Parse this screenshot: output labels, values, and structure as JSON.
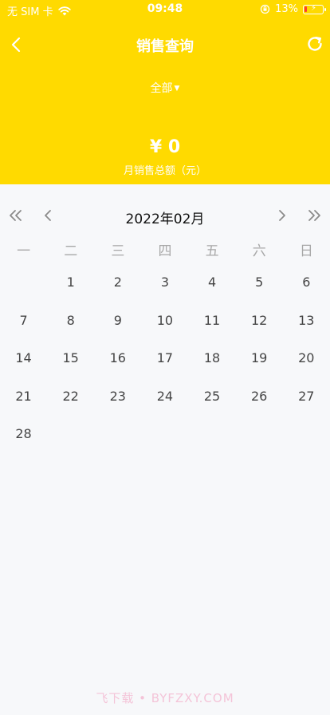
{
  "status_bar": {
    "carrier": "无 SIM 卡",
    "time": "09:48",
    "battery": "13%"
  },
  "nav": {
    "title": "销售查询",
    "back_icon": "chevron-left-icon",
    "refresh_icon": "refresh-icon"
  },
  "filter": {
    "label": "全部"
  },
  "summary": {
    "amount": "¥ 0",
    "label": "月销售总额（元）"
  },
  "calendar": {
    "month": "2022年02月",
    "weekdays": [
      "一",
      "二",
      "三",
      "四",
      "五",
      "六",
      "日"
    ],
    "days": [
      "",
      "1",
      "2",
      "3",
      "4",
      "5",
      "6",
      "7",
      "8",
      "9",
      "10",
      "11",
      "12",
      "13",
      "14",
      "15",
      "16",
      "17",
      "18",
      "19",
      "20",
      "21",
      "22",
      "23",
      "24",
      "25",
      "26",
      "27",
      "28"
    ]
  },
  "watermark": "飞下载 • BYFZXY.COM",
  "colors": {
    "header": "#ffda00",
    "background": "#f7f8fa"
  }
}
